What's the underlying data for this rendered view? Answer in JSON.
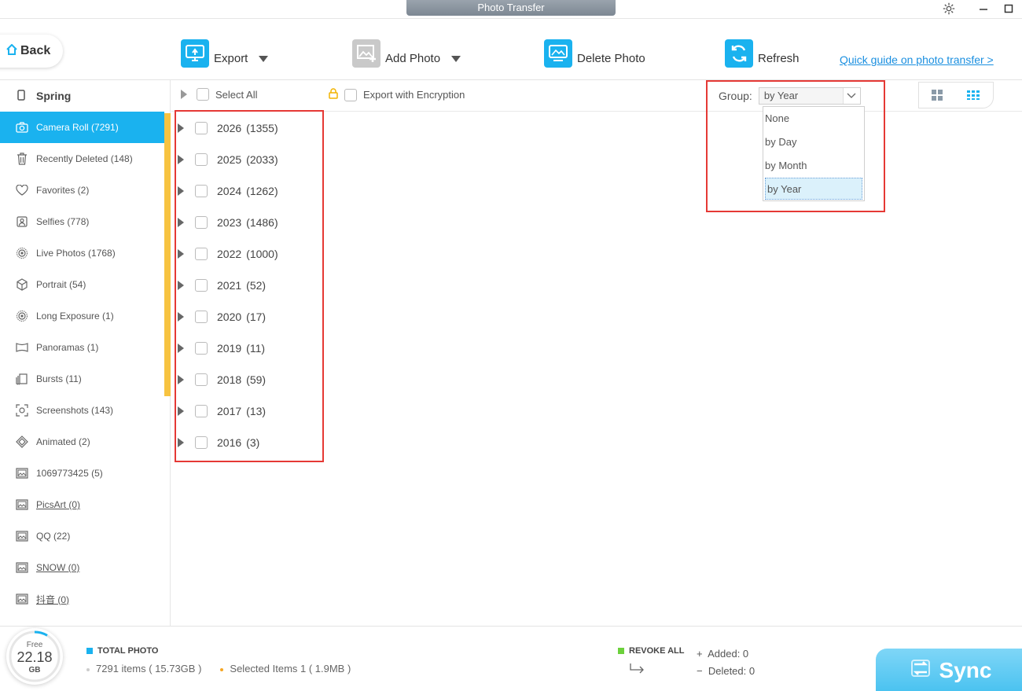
{
  "window": {
    "title": "Photo Transfer"
  },
  "toolbar": {
    "back_label": "Back",
    "export_label": "Export",
    "add_photo_label": "Add Photo",
    "delete_photo_label": "Delete Photo",
    "refresh_label": "Refresh",
    "guide_link": "Quick guide on photo transfer >"
  },
  "sidebar": {
    "device_name": "Spring",
    "items": [
      {
        "label": "Camera Roll (7291)",
        "icon": "camera-icon",
        "active": true
      },
      {
        "label": "Recently Deleted (148)",
        "icon": "trash-icon"
      },
      {
        "label": "Favorites (2)",
        "icon": "heart-icon"
      },
      {
        "label": "Selfies (778)",
        "icon": "person-icon"
      },
      {
        "label": "Live Photos (1768)",
        "icon": "live-photo-icon"
      },
      {
        "label": "Portrait (54)",
        "icon": "cube-icon"
      },
      {
        "label": "Long Exposure (1)",
        "icon": "live-photo-icon"
      },
      {
        "label": "Panoramas (1)",
        "icon": "panorama-icon"
      },
      {
        "label": "Bursts (11)",
        "icon": "bursts-icon"
      },
      {
        "label": "Screenshots (143)",
        "icon": "screenshot-icon"
      },
      {
        "label": "Animated (2)",
        "icon": "animated-icon"
      },
      {
        "label": "1069773425 (5)",
        "icon": "album-icon"
      },
      {
        "label": "PicsArt (0)",
        "icon": "album-icon",
        "link": true
      },
      {
        "label": "QQ (22)",
        "icon": "album-icon"
      },
      {
        "label": "SNOW (0)",
        "icon": "album-icon",
        "link": true
      },
      {
        "label": "抖音 (0)",
        "icon": "album-icon",
        "link": true
      }
    ]
  },
  "content_header": {
    "select_all": "Select All",
    "export_encryption": "Export with Encryption",
    "group_label": "Group:",
    "group_value": "by Year",
    "group_options": [
      "None",
      "by Day",
      "by Month",
      "by Year"
    ]
  },
  "years": [
    {
      "label": "2026",
      "count": "(1355)"
    },
    {
      "label": "2025",
      "count": "(2033)"
    },
    {
      "label": "2024",
      "count": "(1262)"
    },
    {
      "label": "2023",
      "count": "(1486)"
    },
    {
      "label": "2022",
      "count": "(1000)"
    },
    {
      "label": "2021",
      "count": "(52)"
    },
    {
      "label": "2020",
      "count": "(17)"
    },
    {
      "label": "2019",
      "count": "(11)"
    },
    {
      "label": "2018",
      "count": "(59)"
    },
    {
      "label": "2017",
      "count": "(13)"
    },
    {
      "label": "2016",
      "count": "(3)"
    }
  ],
  "footer": {
    "storage_free_label": "Free",
    "storage_value": "22.18",
    "storage_unit": "GB",
    "total_title": "TOTAL PHOTO",
    "total_items": "7291 items ( 15.73GB )",
    "selected_items": "Selected Items 1 ( 1.9MB )",
    "revoke_all": "REVOKE ALL",
    "added": "Added: 0",
    "deleted": "Deleted: 0",
    "sync_label": "Sync"
  },
  "colors": {
    "accent": "#1ab2ef",
    "scroll_accent": "#f7c341",
    "highlight_box": "#e53935",
    "link": "#1a8fe0"
  }
}
